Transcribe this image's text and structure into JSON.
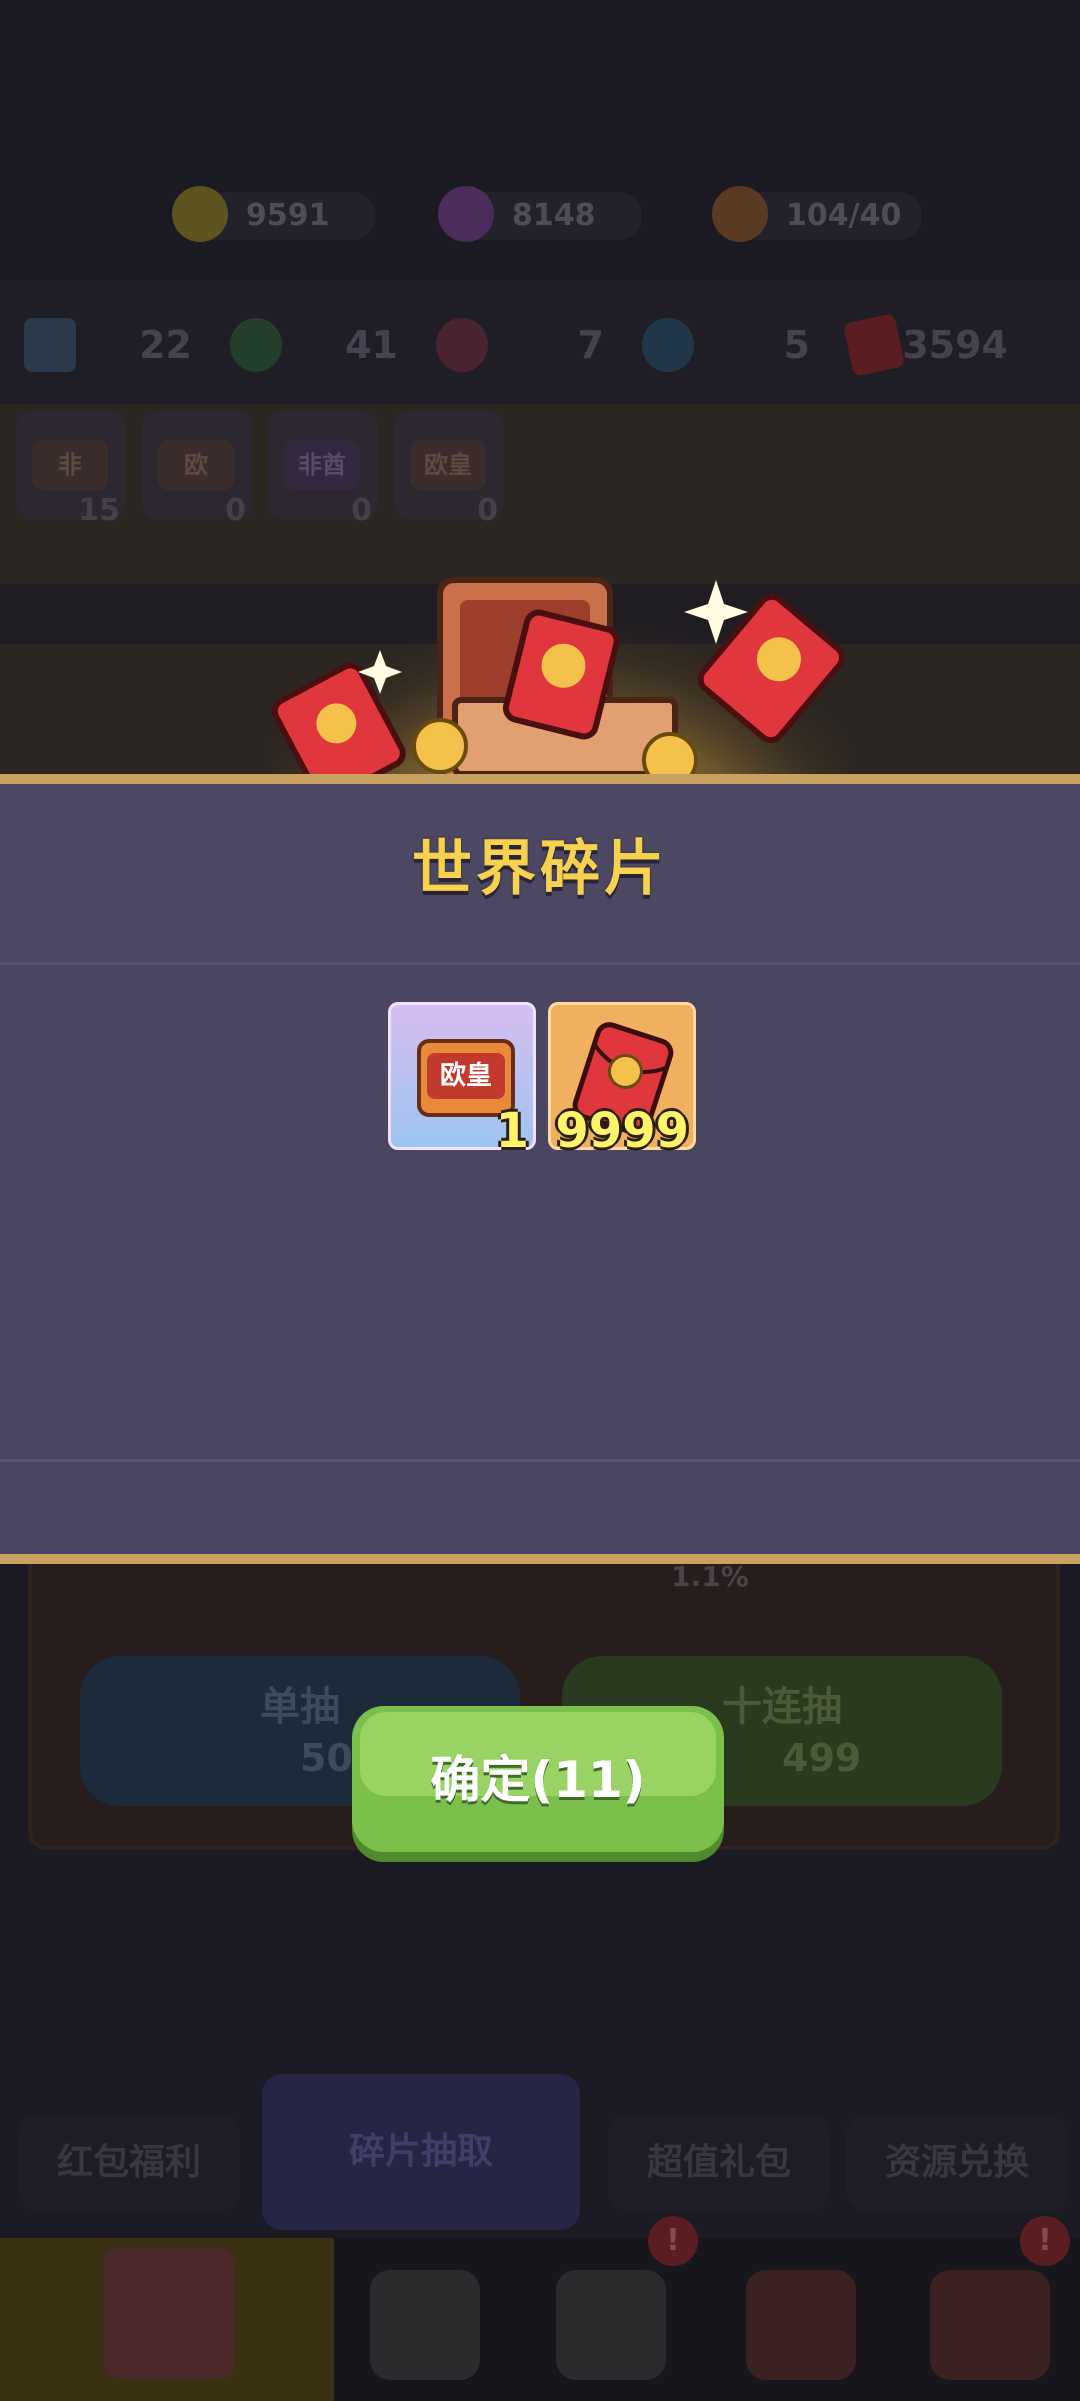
{
  "currencies": [
    {
      "icon": "gold-coin-icon",
      "value": "9591"
    },
    {
      "icon": "purple-gem-icon",
      "value": "8148"
    },
    {
      "icon": "stamina-icon",
      "value": "104/40"
    }
  ],
  "resources": [
    {
      "icon": "scissors-icon",
      "value": "22"
    },
    {
      "icon": "clover-icon",
      "value": "41"
    },
    {
      "icon": "red-potion-icon",
      "value": "7"
    },
    {
      "icon": "blue-potion-icon",
      "value": "5"
    },
    {
      "icon": "red-envelope-icon",
      "value": "3594"
    }
  ],
  "fragment_badges": [
    {
      "label": "非",
      "count": "15"
    },
    {
      "label": "欧",
      "count": "0"
    },
    {
      "label": "非酋",
      "count": "0"
    },
    {
      "label": "欧皇",
      "count": "0"
    }
  ],
  "draw_panel": {
    "rate_text": "1.1%",
    "single_draw": {
      "label": "单抽",
      "cost": "50"
    },
    "ten_draw": {
      "label": "十连抽",
      "cost": "499"
    }
  },
  "modal": {
    "title": "世界碎片",
    "rewards": [
      {
        "name": "oh-huang-fragment",
        "badge_text": "欧皇",
        "qty": "1"
      },
      {
        "name": "red-envelope",
        "qty": "9999"
      }
    ],
    "confirm_label": "确定(11)"
  },
  "tabs": [
    "红包福利",
    "碎片抽取",
    "超值礼包",
    "资源兑换"
  ],
  "colors": {
    "title": "#f7d24f",
    "confirm": "#7bc04d",
    "modal_bg": "#4a4660",
    "gold_line": "#c8a261"
  }
}
